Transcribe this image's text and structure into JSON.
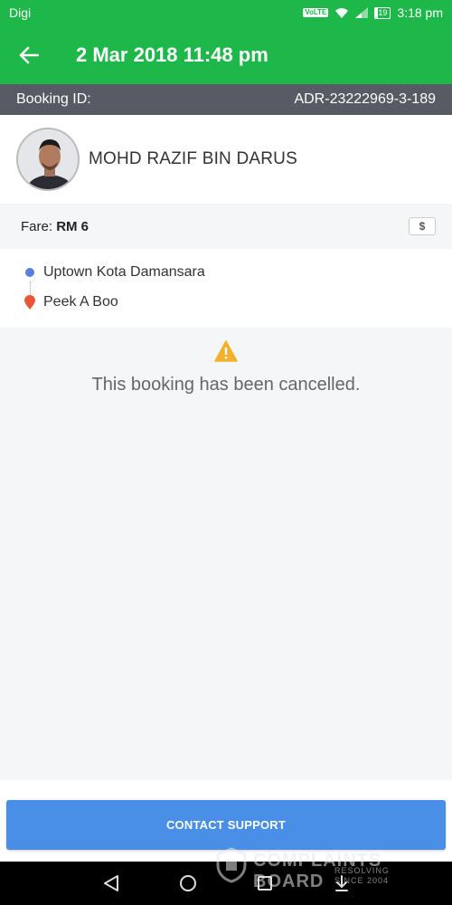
{
  "status_bar": {
    "carrier": "Digi",
    "volte": "VoLTE",
    "battery": "19",
    "time": "3:18 pm"
  },
  "header": {
    "title": "2 Mar 2018 11:48 pm",
    "back_icon": "arrow-left-icon"
  },
  "booking": {
    "label": "Booking ID:",
    "id": "ADR-23222969-3-189"
  },
  "driver": {
    "name": "MOHD RAZIF BIN DARUS"
  },
  "fare": {
    "label": "Fare:",
    "value": "RM 6",
    "icon_text": "$"
  },
  "route": {
    "pickup": "Uptown Kota Damansara",
    "dropoff": "Peek A Boo"
  },
  "notice": {
    "text": "This booking has been cancelled."
  },
  "actions": {
    "contact_support": "CONTACT SUPPORT"
  },
  "watermark": {
    "main": "COMPLAINTS BOARD",
    "sub1": "RESOLVING",
    "sub2": "SINCE 2004"
  },
  "colors": {
    "brand": "#1eb84a",
    "strip": "#585a64",
    "button": "#4a8fe7",
    "pickup": "#5b7fe0",
    "dropoff": "#e8563a",
    "warning": "#f2b12b"
  }
}
